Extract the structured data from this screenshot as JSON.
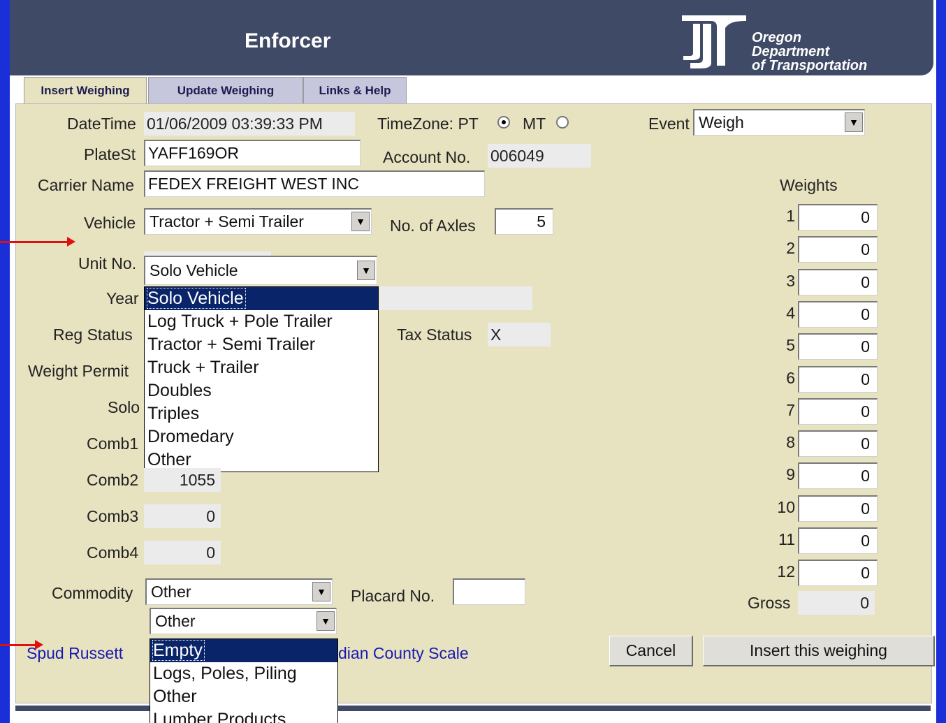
{
  "app": {
    "title": "Enforcer",
    "org_line1": "Oregon",
    "org_line2": "Department",
    "org_line3": "of Transportation"
  },
  "tabs": [
    {
      "label": "Insert Weighing",
      "active": true
    },
    {
      "label": "Update Weighing",
      "active": false
    },
    {
      "label": "Links & Help",
      "active": false
    }
  ],
  "form": {
    "datetime_label": "DateTime",
    "datetime_value": "01/06/2009 03:39:33 PM",
    "timezone_label": "TimeZone: PT",
    "tz_mt_label": "MT",
    "tz_selected": "PT",
    "event_label": "Event",
    "event_value": "Weigh",
    "platest_label": "PlateSt",
    "platest_value": "YAFF169OR",
    "account_label": "Account No.",
    "account_value": "006049",
    "carrier_label": "Carrier Name",
    "carrier_value": "FEDEX FREIGHT WEST INC",
    "vehicle_label": "Vehicle",
    "vehicle_value": "Tractor + Semi Trailer",
    "axles_label": "No. of Axles",
    "axles_value": "5",
    "unit_label": "Unit No.",
    "unit_value": "Solo Vehicle",
    "year_label": "Year",
    "reg_status_label": "Reg Status",
    "tax_status_label": "Tax Status",
    "tax_status_value": "X",
    "weight_permit_label": "Weight Permit",
    "solo_label": "Solo",
    "comb1_label": "Comb1",
    "comb2_label": "Comb2",
    "comb2_value": "1055",
    "comb3_label": "Comb3",
    "comb3_value": "0",
    "comb4_label": "Comb4",
    "comb4_value": "0",
    "commodity_label": "Commodity",
    "commodity_value": "Other",
    "commodity2_value": "Other",
    "placard_label": "Placard No.",
    "placard_value": ""
  },
  "unit_dropdown": {
    "options": [
      "Solo Vehicle",
      "Log Truck + Pole Trailer",
      "Tractor + Semi Trailer",
      "Truck + Trailer",
      "Doubles",
      "Triples",
      "Dromedary",
      "Other"
    ],
    "selected_index": 0
  },
  "commodity_dropdown": {
    "options": [
      "Empty",
      "Logs, Poles, Piling",
      "Other",
      "Lumber Products"
    ],
    "selected_index": 0
  },
  "weights": {
    "title": "Weights",
    "rows": [
      {
        "n": "1",
        "v": "0"
      },
      {
        "n": "2",
        "v": "0"
      },
      {
        "n": "3",
        "v": "0"
      },
      {
        "n": "4",
        "v": "0"
      },
      {
        "n": "5",
        "v": "0"
      },
      {
        "n": "6",
        "v": "0"
      },
      {
        "n": "7",
        "v": "0"
      },
      {
        "n": "8",
        "v": "0"
      },
      {
        "n": "9",
        "v": "0"
      },
      {
        "n": "10",
        "v": "0"
      },
      {
        "n": "11",
        "v": "0"
      },
      {
        "n": "12",
        "v": "0"
      }
    ],
    "gross_label": "Gross",
    "gross_value": "0"
  },
  "footer": {
    "user_link": "Spud Russett",
    "scale_link": "dian County Scale",
    "cancel_label": "Cancel",
    "insert_label": "Insert this weighing"
  }
}
